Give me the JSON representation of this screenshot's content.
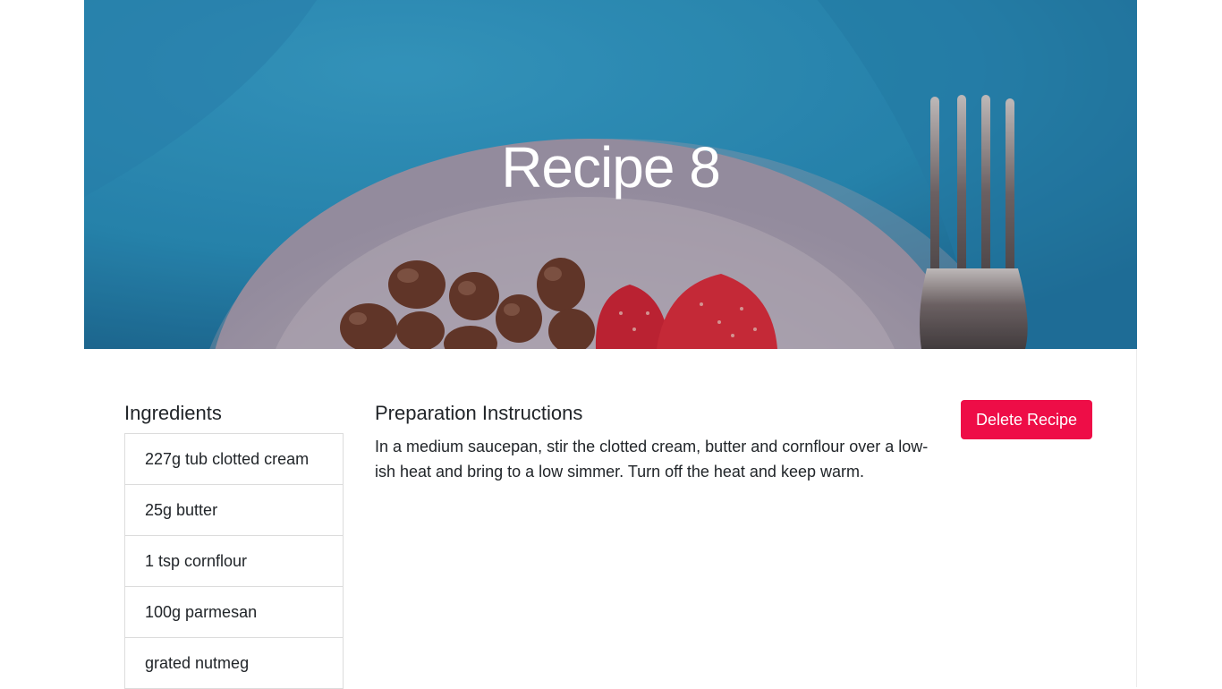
{
  "recipe": {
    "title": "Recipe 8",
    "hero_image": "plate-with-hazelnuts-strawberries-and-fork"
  },
  "ingredients": {
    "heading": "Ingredients",
    "items": [
      "227g tub clotted cream",
      "25g butter",
      "1 tsp cornflour",
      "100g parmesan",
      "grated nutmeg"
    ]
  },
  "instructions": {
    "heading": "Preparation Instructions",
    "text": "In a medium saucepan, stir the clotted cream, butter and cornflour over a low-ish heat and bring to a low simmer. Turn off the heat and keep warm."
  },
  "actions": {
    "delete_label": "Delete Recipe"
  },
  "colors": {
    "accent": "#ee0d47",
    "hero_background": "#2e97c4"
  }
}
